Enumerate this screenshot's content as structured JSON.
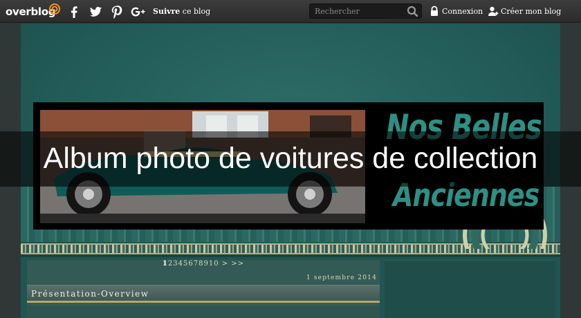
{
  "topbar": {
    "logo": "overblog",
    "social_icons": [
      "facebook-icon",
      "twitter-icon",
      "pinterest-icon",
      "google-plus-icon"
    ],
    "follow_bold": "Suivre",
    "follow_rest": " ce blog",
    "search_placeholder": "Rechercher",
    "login_label": "Connexion",
    "create_label": "Créer mon blog"
  },
  "banner": {
    "line1": "Nos Belles",
    "line2": "Anciennes"
  },
  "page_title": "Album photo de voitures de collection",
  "pagination": {
    "pages": [
      "1",
      "2",
      "3",
      "4",
      "5",
      "6",
      "7",
      "8",
      "9",
      "10"
    ],
    "current": "1",
    "next": ">",
    "last": ">>"
  },
  "post": {
    "date": "1 septembre 2014",
    "title": "Présentation-Overview"
  },
  "colors": {
    "topbar": "#333333",
    "teal_background": "#235d59",
    "banner_text": "#2e8f85",
    "accent_gold": "#b8a86a"
  }
}
